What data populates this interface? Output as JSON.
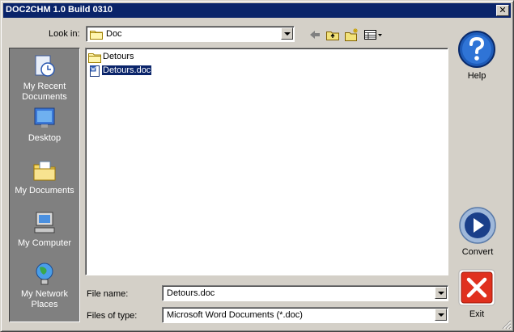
{
  "window": {
    "title": "DOC2CHM 1.0 Build 0310",
    "close_glyph": "✕"
  },
  "lookin": {
    "label": "Look in:",
    "value": "Doc"
  },
  "toolbar": {
    "back": "back-arrow-icon",
    "up": "up-folder-icon",
    "new_folder": "new-folder-icon",
    "view": "view-menu-icon"
  },
  "places": [
    {
      "label": "My Recent Documents",
      "icon": "recent-documents-icon"
    },
    {
      "label": "Desktop",
      "icon": "desktop-icon"
    },
    {
      "label": "My Documents",
      "icon": "my-documents-icon"
    },
    {
      "label": "My Computer",
      "icon": "my-computer-icon"
    },
    {
      "label": "My Network Places",
      "icon": "network-places-icon"
    }
  ],
  "files": [
    {
      "name": "Detours",
      "type": "folder",
      "selected": false
    },
    {
      "name": "Detours.doc",
      "type": "word-document",
      "selected": true
    }
  ],
  "filename": {
    "label": "File name:",
    "value": "Detours.doc"
  },
  "filetype": {
    "label": "Files of type:",
    "value": "Microsoft Word Documents (*.doc)"
  },
  "buttons": {
    "help": "Help",
    "convert": "Convert",
    "exit": "Exit"
  },
  "colors": {
    "titlebar": "#0a246a",
    "face": "#d4d0c8",
    "places_bg": "#808080",
    "selection": "#0a246a",
    "help_blue": "#1e5bb8",
    "exit_red": "#e0301e"
  }
}
